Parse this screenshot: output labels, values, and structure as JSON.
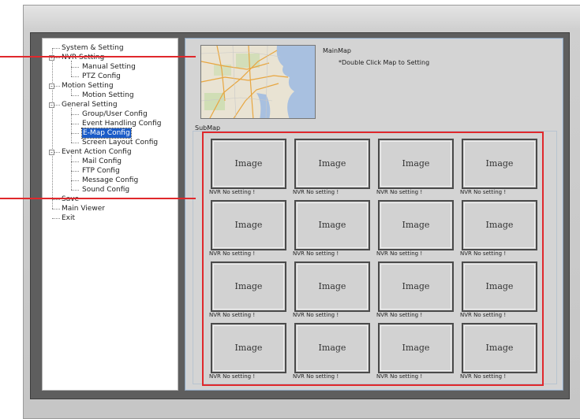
{
  "tree": {
    "items": [
      {
        "label": "System & Setting",
        "expander": ""
      },
      {
        "label": "NVR  Setting",
        "expander": "-"
      },
      {
        "label": "Manual Setting",
        "expander": ""
      },
      {
        "label": "PTZ Config",
        "expander": ""
      },
      {
        "label": "Motion Setting",
        "expander": "-"
      },
      {
        "label": "Motion Setting",
        "expander": ""
      },
      {
        "label": "General Setting",
        "expander": "-"
      },
      {
        "label": "Group/User Config",
        "expander": ""
      },
      {
        "label": "Event Handling Config",
        "expander": ""
      },
      {
        "label": "E-Map Config",
        "expander": "",
        "selected": true
      },
      {
        "label": "Screen Layout Config",
        "expander": ""
      },
      {
        "label": "Event Action Config",
        "expander": "-"
      },
      {
        "label": "Mail Config",
        "expander": ""
      },
      {
        "label": "FTP Config",
        "expander": ""
      },
      {
        "label": "Message Config",
        "expander": ""
      },
      {
        "label": "Sound Config",
        "expander": ""
      },
      {
        "label": "Save",
        "expander": ""
      },
      {
        "label": "Main Viewer",
        "expander": ""
      },
      {
        "label": "Exit",
        "expander": ""
      }
    ]
  },
  "mainmap": {
    "title": "MainMap",
    "hint": "*Double Click Map to Setting"
  },
  "submap": {
    "title": "SubMap",
    "cell_label": "Image",
    "cell_status": "NVR  No setting !",
    "rows": 4,
    "cols": 4
  },
  "colors": {
    "highlight": "#e0282c",
    "selection": "#1b5cc8"
  }
}
